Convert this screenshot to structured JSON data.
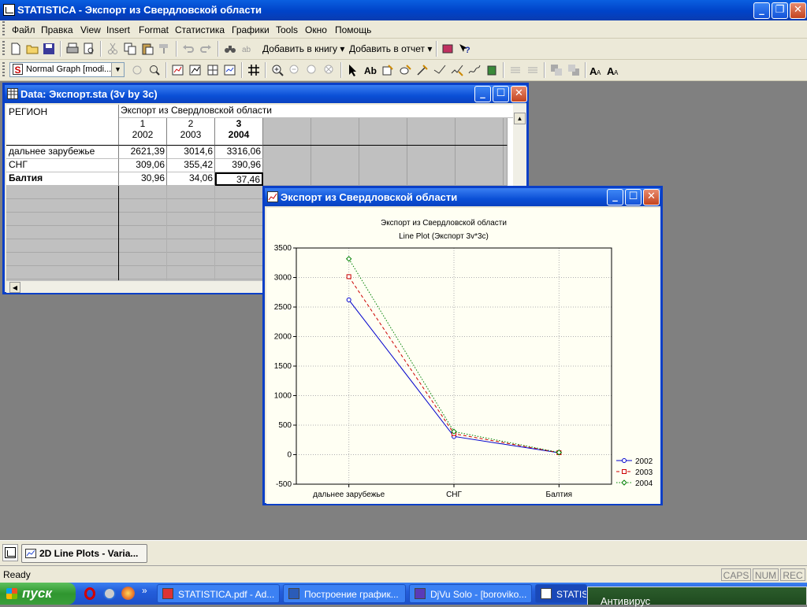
{
  "app": {
    "title": "STATISTICA - Экспорт из Свердловской области"
  },
  "menu": [
    "Файл",
    "Правка",
    "View",
    "Insert",
    "Format",
    "Статистика",
    "Графики",
    "Tools",
    "Окно",
    "Помощь"
  ],
  "toolbar": {
    "add_to_book": "Добавить в книгу",
    "add_to_report": "Добавить в отчет",
    "graph_style": "Normal Graph [modi..."
  },
  "data_window": {
    "title": "Data: Экспорт.sta (3v by 3c)",
    "region_header": "РЕГИОН",
    "group_header": "Экспорт из Свердловской области",
    "columns": [
      {
        "num": "1",
        "name": "2002"
      },
      {
        "num": "2",
        "name": "2003"
      },
      {
        "num": "3",
        "name": "2004"
      }
    ],
    "rows": [
      {
        "label": "дальнее зарубежье",
        "values": [
          "2621,39",
          "3014,6",
          "3316,06"
        ]
      },
      {
        "label": "СНГ",
        "values": [
          "309,06",
          "355,42",
          "390,96"
        ]
      },
      {
        "label": "Балтия",
        "values": [
          "30,96",
          "34,06",
          "37,46"
        ]
      }
    ]
  },
  "graph_window": {
    "title": "Экспорт из Свердловской области"
  },
  "chart_data": {
    "type": "line",
    "title": "Экспорт из Свердловской области",
    "subtitle": "Line Plot (Экспорт 3v*3c)",
    "categories": [
      "дальнее зарубежье",
      "СНГ",
      "Балтия"
    ],
    "series": [
      {
        "name": "2002",
        "values": [
          2621.39,
          309.06,
          30.96
        ],
        "color": "#0000cc",
        "marker": "circle",
        "dash": "solid"
      },
      {
        "name": "2003",
        "values": [
          3014.6,
          355.42,
          34.06
        ],
        "color": "#cc0000",
        "marker": "square",
        "dash": "dashed"
      },
      {
        "name": "2004",
        "values": [
          3316.06,
          390.96,
          37.46
        ],
        "color": "#008000",
        "marker": "diamond",
        "dash": "dotted"
      }
    ],
    "yticks": [
      -500,
      0,
      500,
      1000,
      1500,
      2000,
      2500,
      3000,
      3500
    ],
    "ylim": [
      -500,
      3500
    ],
    "grid": true,
    "legend_position": "right"
  },
  "mdi_task": {
    "label": "2D Line Plots - Varia..."
  },
  "status": {
    "text": "Ready",
    "indicators": [
      "CAPS",
      "NUM",
      "REC"
    ]
  },
  "taskbar": {
    "start_label": "пуск",
    "tasks": [
      "STATISTICA.pdf - Ad...",
      "Построение график...",
      "DjVu Solo - [boroviko...",
      "STATIS"
    ],
    "tray_popup": "Антивирус"
  }
}
